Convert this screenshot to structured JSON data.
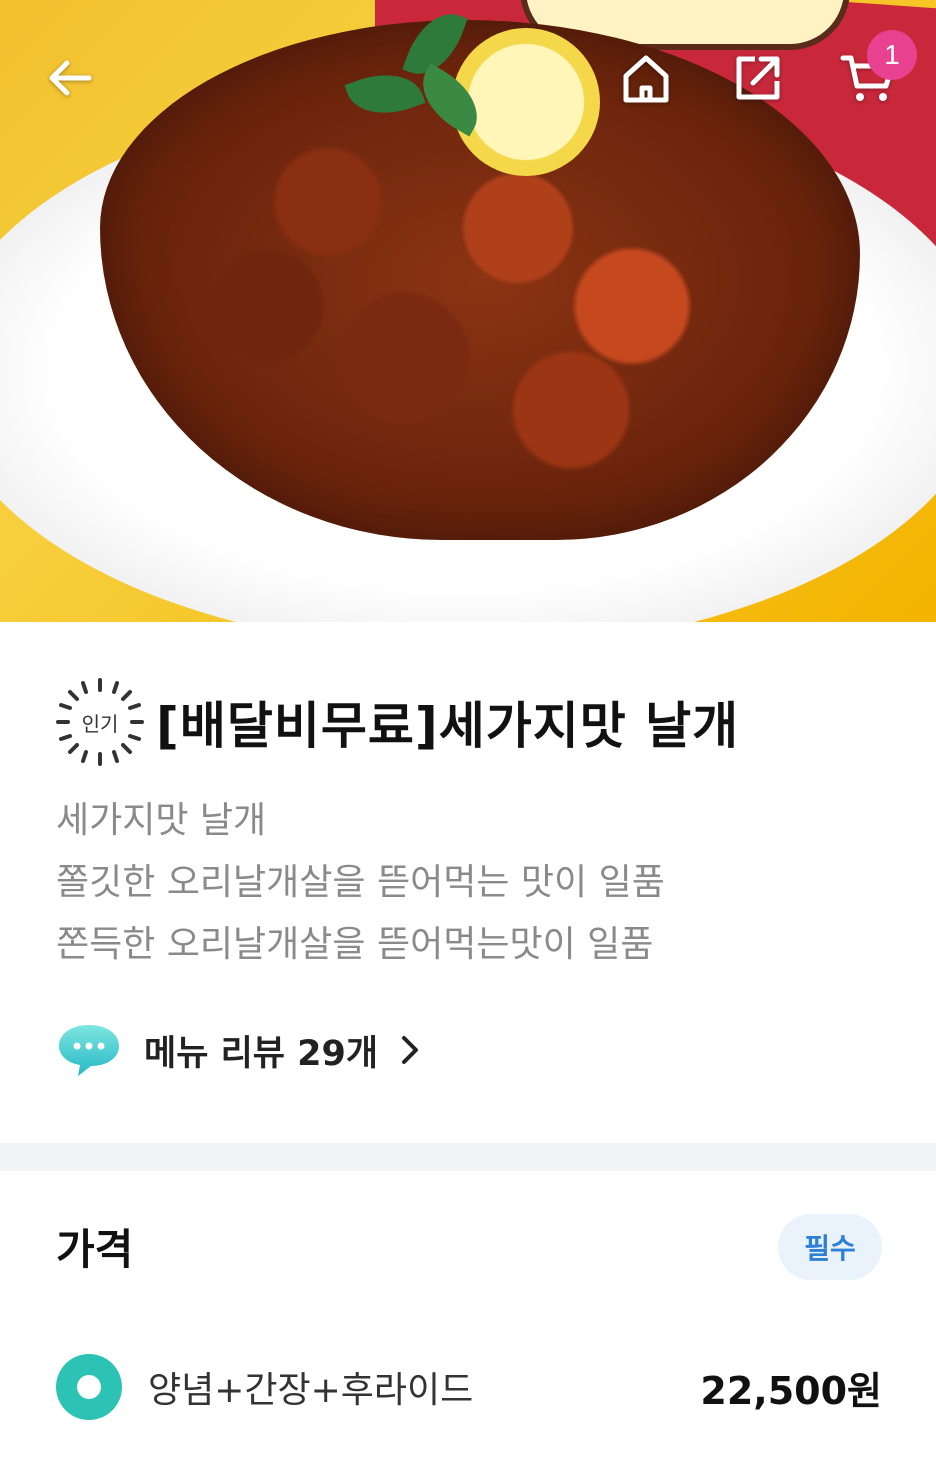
{
  "header": {
    "cart_count": "1",
    "icons": [
      "back-arrow-icon",
      "home-icon",
      "share-icon",
      "cart-icon"
    ]
  },
  "menu": {
    "badge": "인기",
    "title": "[배달비무료]세가지맛 날개",
    "description": [
      "세가지맛 날개",
      "쫄깃한 오리날개살을 뜯어먹는 맛이 일품",
      "쫀득한 오리날개살을 뜯어먹는맛이 일품"
    ],
    "review_link": "메뉴 리뷰 29개"
  },
  "price_section": {
    "title": "가격",
    "required_badge": "필수",
    "options": [
      {
        "label": "양념+간장+후라이드",
        "price": "22,500원",
        "selected": true
      }
    ]
  },
  "colors": {
    "accent_teal": "#2cc3b4",
    "badge_pink": "#e8418f",
    "required_blue": "#2d80d6",
    "required_bg": "#eaf3fc"
  }
}
